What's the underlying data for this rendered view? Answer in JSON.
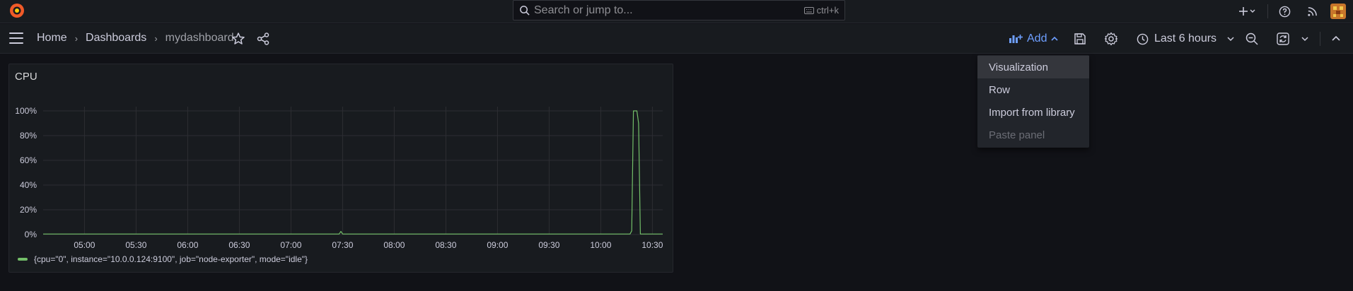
{
  "topbar": {
    "logo_icon": "grafana-logo-icon",
    "search": {
      "placeholder": "Search or jump to...",
      "shortcut": "ctrl+k"
    },
    "icons": [
      "plus-icon",
      "help-icon",
      "rss-icon",
      "user-avatar"
    ]
  },
  "navbar": {
    "breadcrumbs": [
      "Home",
      "Dashboards",
      "mydashboard"
    ],
    "add_label": "Add",
    "time_range": "Last 6 hours"
  },
  "add_menu": {
    "items": [
      {
        "label": "Visualization",
        "state": "hover"
      },
      {
        "label": "Row",
        "state": "normal"
      },
      {
        "label": "Import from library",
        "state": "normal"
      },
      {
        "label": "Paste panel",
        "state": "disabled"
      }
    ]
  },
  "panel": {
    "title": "CPU",
    "legend": "{cpu=\"0\", instance=\"10.0.0.124:9100\", job=\"node-exporter\", mode=\"idle\"}"
  },
  "chart_data": {
    "type": "line",
    "title": "CPU",
    "xlabel": "",
    "ylabel": "",
    "ylim": [
      0,
      100
    ],
    "y_ticks": [
      "0%",
      "20%",
      "40%",
      "60%",
      "80%",
      "100%"
    ],
    "x_ticks": [
      "05:00",
      "05:30",
      "06:00",
      "06:30",
      "07:00",
      "07:30",
      "08:00",
      "08:30",
      "09:00",
      "09:30",
      "10:00",
      "10:30"
    ],
    "grid": true,
    "legend_position": "bottom-left",
    "series": [
      {
        "name": "{cpu=\"0\", instance=\"10.0.0.124:9100\", job=\"node-exporter\", mode=\"idle\"}",
        "color": "#73bf69",
        "points": [
          [
            "04:36",
            0.4
          ],
          [
            "05:00",
            0.4
          ],
          [
            "05:30",
            0.4
          ],
          [
            "06:00",
            0.4
          ],
          [
            "06:30",
            0.4
          ],
          [
            "07:00",
            0.4
          ],
          [
            "07:28",
            0.4
          ],
          [
            "07:29",
            2.5
          ],
          [
            "07:30",
            0.4
          ],
          [
            "08:00",
            0.4
          ],
          [
            "08:30",
            0.4
          ],
          [
            "09:00",
            0.4
          ],
          [
            "09:30",
            0.4
          ],
          [
            "10:00",
            0.4
          ],
          [
            "10:17",
            0.4
          ],
          [
            "10:18",
            3
          ],
          [
            "10:19",
            100
          ],
          [
            "10:21",
            100
          ],
          [
            "10:22",
            90
          ],
          [
            "10:23",
            0.4
          ],
          [
            "10:36",
            0.4
          ]
        ]
      }
    ]
  }
}
